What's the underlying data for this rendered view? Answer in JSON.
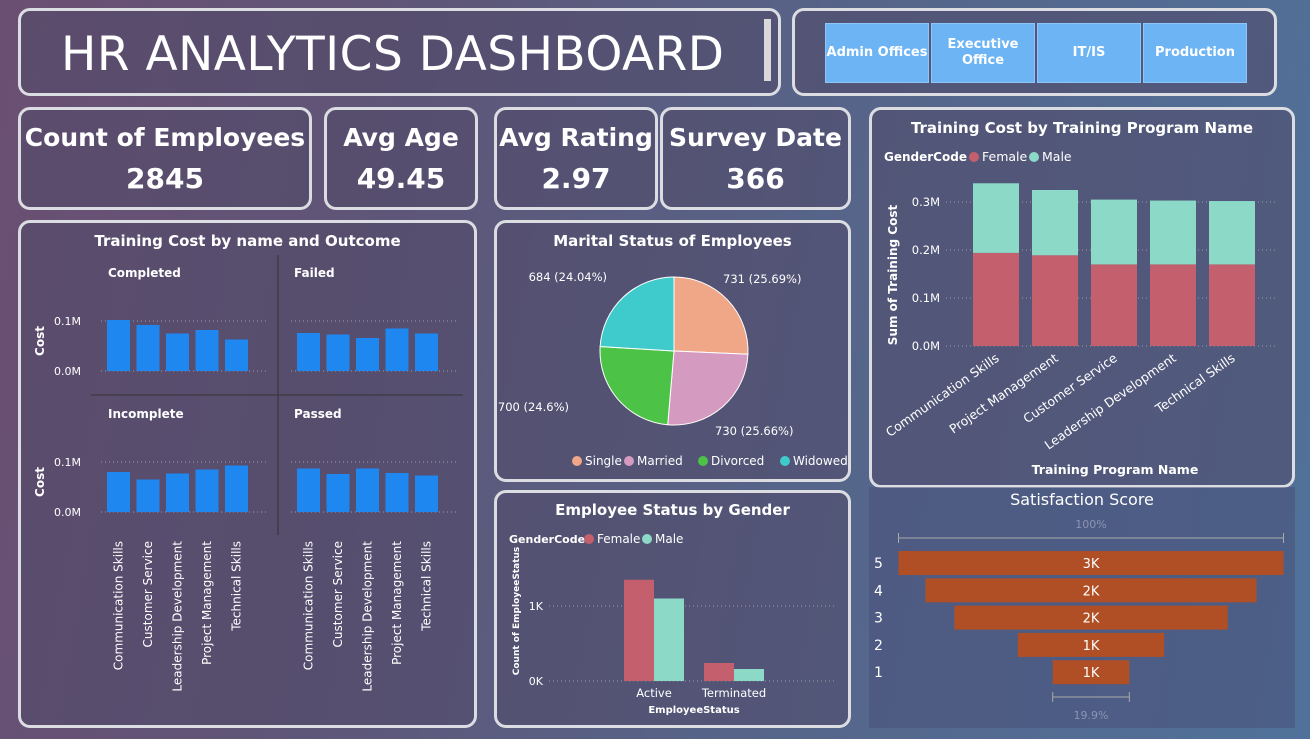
{
  "header": {
    "title": "HR ANALYTICS DASHBOARD",
    "departments": [
      "Admin Offices",
      "Executive Office",
      "IT/IS",
      "Production"
    ]
  },
  "kpis": [
    {
      "label": "Count of Employees",
      "value": "2845"
    },
    {
      "label": "Avg Age",
      "value": "49.45"
    },
    {
      "label": "Avg Rating",
      "value": "2.97"
    },
    {
      "label": "Survey Date",
      "value": "366"
    }
  ],
  "colors": {
    "bar_blue": "#1e87f0",
    "female": "#c4606d",
    "male": "#8dd9c8",
    "funnel": "#b04f26"
  },
  "chart_data": [
    {
      "id": "training_outcome",
      "type": "bar",
      "title": "Training Cost by name and Outcome",
      "ylabel": "Cost",
      "ytick_labels": [
        "0.0M",
        "0.1M"
      ],
      "ylim": [
        0,
        0.12
      ],
      "categories": [
        "Communication Skills",
        "Customer Service",
        "Leadership Development",
        "Project Management",
        "Technical Skills"
      ],
      "panels": [
        {
          "name": "Completed",
          "values": [
            0.102,
            0.092,
            0.075,
            0.082,
            0.063
          ]
        },
        {
          "name": "Failed",
          "values": [
            0.076,
            0.073,
            0.066,
            0.085,
            0.075
          ]
        },
        {
          "name": "Incomplete",
          "values": [
            0.08,
            0.065,
            0.077,
            0.085,
            0.093
          ]
        },
        {
          "name": "Passed",
          "values": [
            0.087,
            0.076,
            0.087,
            0.078,
            0.073
          ]
        }
      ]
    },
    {
      "id": "marital_status",
      "type": "pie",
      "title": "Marital Status of Employees",
      "slices": [
        {
          "label": "Single",
          "value": 731,
          "text": "731 (25.69%)",
          "color": "#f0a788"
        },
        {
          "label": "Married",
          "value": 730,
          "text": "730 (25.66%)",
          "color": "#d59ac0"
        },
        {
          "label": "Divorced",
          "value": 700,
          "text": "700 (24.6%)",
          "color": "#4cc346"
        },
        {
          "label": "Widowed",
          "value": 684,
          "text": "684 (24.04%)",
          "color": "#3fcbcb"
        }
      ]
    },
    {
      "id": "status_gender",
      "type": "bar",
      "title": "Employee Status by Gender",
      "legend_title": "GenderCode",
      "xlabel": "EmployeeStatus",
      "ylabel": "Count of EmployeeStatus",
      "ytick_labels": [
        "0K",
        "1K"
      ],
      "ylim": [
        0,
        1600
      ],
      "categories": [
        "Active",
        "Terminated"
      ],
      "series": [
        {
          "name": "Female",
          "values": [
            1350,
            240
          ]
        },
        {
          "name": "Male",
          "values": [
            1100,
            160
          ]
        }
      ]
    },
    {
      "id": "training_cost_program",
      "type": "bar",
      "stacked": true,
      "title": "Training Cost by Training Program Name",
      "legend_title": "GenderCode",
      "xlabel": "Training Program Name",
      "ylabel": "Sum of Training Cost",
      "ytick_labels": [
        "0.0M",
        "0.1M",
        "0.2M",
        "0.3M"
      ],
      "ylim": [
        0,
        0.36
      ],
      "categories": [
        "Communication Skills",
        "Project Management",
        "Customer Service",
        "Leadership Development",
        "Technical Skills"
      ],
      "series": [
        {
          "name": "Female",
          "values": [
            0.194,
            0.189,
            0.17,
            0.17,
            0.17
          ]
        },
        {
          "name": "Male",
          "values": [
            0.145,
            0.136,
            0.135,
            0.133,
            0.132
          ]
        }
      ]
    },
    {
      "id": "satisfaction",
      "type": "funnel",
      "title": "Satisfaction Score",
      "top_percent": "100%",
      "bottom_percent": "19.9%",
      "stages": [
        {
          "label": "5",
          "value": 1.0,
          "text": "3K"
        },
        {
          "label": "4",
          "value": 0.86,
          "text": "2K"
        },
        {
          "label": "3",
          "value": 0.71,
          "text": "2K"
        },
        {
          "label": "2",
          "value": 0.38,
          "text": "1K"
        },
        {
          "label": "1",
          "value": 0.199,
          "text": "1K"
        }
      ]
    }
  ]
}
